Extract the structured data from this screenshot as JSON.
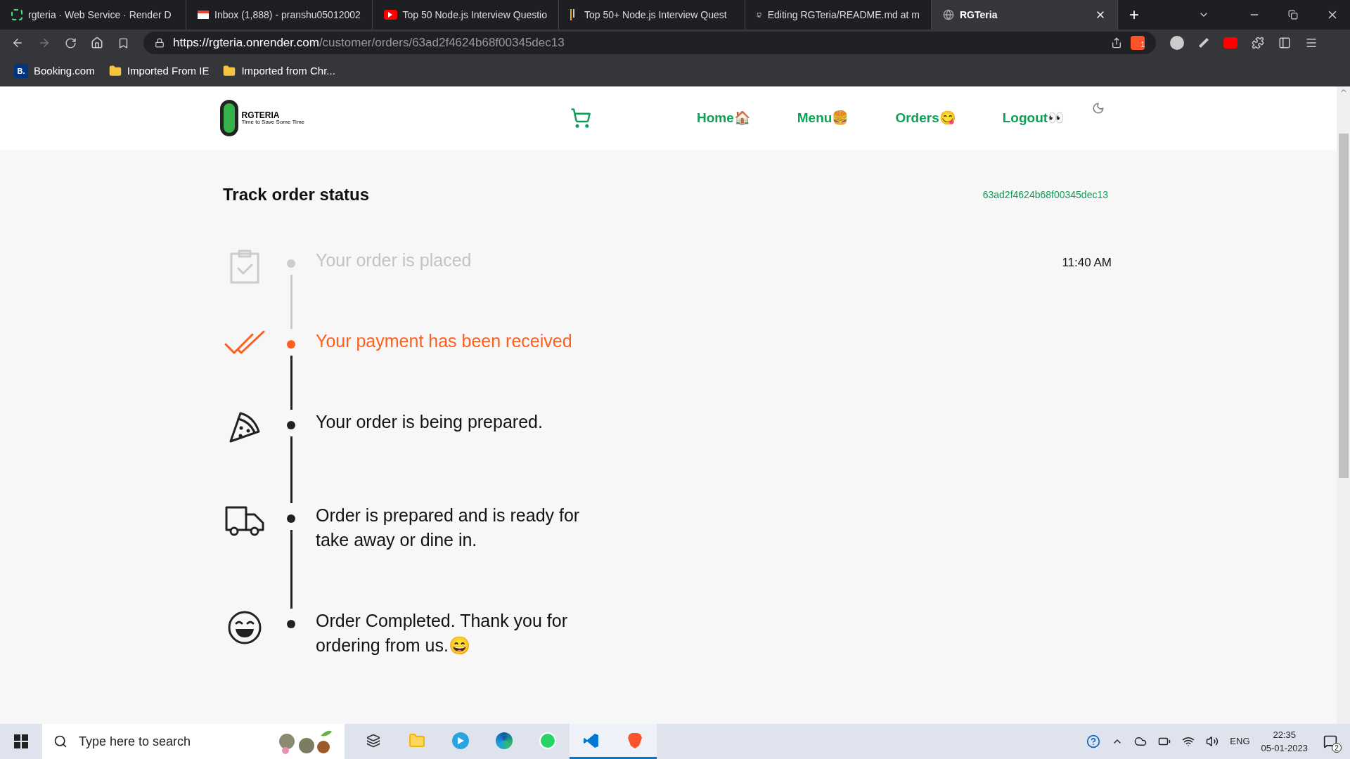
{
  "browser": {
    "tabs": [
      {
        "title": "rgteria · Web Service · Render D",
        "selected": false
      },
      {
        "title": "Inbox (1,888) - pranshu05012002",
        "selected": false
      },
      {
        "title": "Top 50 Node.js Interview Questio",
        "selected": false
      },
      {
        "title": "Top 50+ Node.js Interview Quest",
        "selected": false
      },
      {
        "title": "Editing RGTeria/README.md at m",
        "selected": false
      },
      {
        "title": "RGTeria",
        "selected": true
      }
    ],
    "new_tab": "+",
    "url_host": "https://rgteria.onrender.com",
    "url_path": "/customer/orders/63ad2f4624b68f00345dec13",
    "shield_count": "1",
    "bookmarks": [
      {
        "label": "Booking.com",
        "badge": "B."
      },
      {
        "label": "Imported From IE"
      },
      {
        "label": "Imported from Chr..."
      }
    ]
  },
  "header": {
    "logo_text": "RGTERIA",
    "logo_tagline": "Time to Save Some Time",
    "nav": [
      "Home🏠",
      "Menu🍔",
      "Orders😋",
      "Logout👀"
    ]
  },
  "tracking": {
    "title": "Track order status",
    "order_id": "63ad2f4624b68f00345dec13",
    "steps": [
      {
        "kind": "clipboard",
        "text": "Your order is placed",
        "done": true,
        "current": false,
        "time": "11:40 AM"
      },
      {
        "kind": "doublecheck",
        "text": "Your payment has been received",
        "done": false,
        "current": true
      },
      {
        "kind": "pizza",
        "text": "Your order is being prepared.",
        "done": false,
        "current": false
      },
      {
        "kind": "truck",
        "text": "Order is prepared and is ready for take away or dine in.",
        "done": false,
        "current": false
      },
      {
        "kind": "smile",
        "text": "Order Completed. Thank you for ordering from us.😄",
        "done": false,
        "current": false
      }
    ]
  },
  "taskbar": {
    "search_placeholder": "Type here to search",
    "apps": [
      {
        "selected": false
      },
      {
        "selected": false
      },
      {
        "selected": false
      },
      {
        "selected": false
      },
      {
        "selected": false
      },
      {
        "selected": true
      },
      {
        "selected": true
      }
    ],
    "language": "ENG",
    "time": "22:35",
    "date": "05-01-2023",
    "notifications": "2"
  }
}
